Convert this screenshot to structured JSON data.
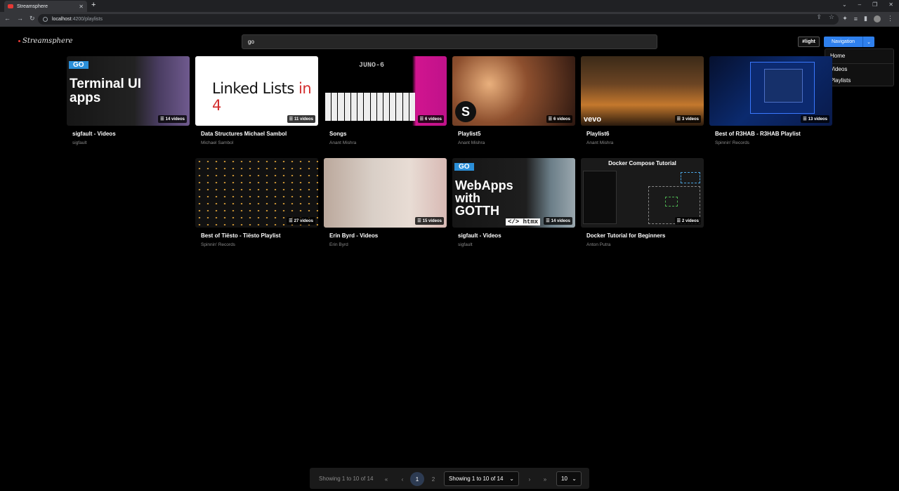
{
  "browser": {
    "tab_title": "Streamsphere",
    "url_host": "localhost",
    "url_path": ":4200/playlists"
  },
  "app": {
    "logo_text": "Streamsphere",
    "search_value": "go",
    "theme_button": "#light",
    "nav_button": "Navigation",
    "nav_menu": [
      "Home",
      "Videos",
      "Playlists"
    ]
  },
  "playlists": [
    {
      "title": "sigfault - Videos",
      "author": "sigfault",
      "count": "14 videos",
      "thumb_text": [
        "GO",
        "Terminal UI",
        "apps"
      ]
    },
    {
      "title": "Data Structures Michael Sambol",
      "author": "Michael Sambol",
      "count": "11 videos",
      "thumb_text": [
        "Linked Lists ",
        "in 4"
      ]
    },
    {
      "title": "Songs",
      "author": "Anant Mishra",
      "count": "6 videos",
      "thumb_text": [
        "JUNO-6"
      ]
    },
    {
      "title": "Playlist5",
      "author": "Anant Mishra",
      "count": "6 videos",
      "thumb_text": [
        "S"
      ]
    },
    {
      "title": "Playlist6",
      "author": "Anant Mishra",
      "count": "3 videos",
      "thumb_text": [
        "vevo"
      ]
    },
    {
      "title": "Best of R3HAB - R3HAB Playlist",
      "author": "Spinnin' Records",
      "count": "13 videos",
      "thumb_text": []
    },
    {
      "title": "Best of Tiësto - Tiësto Playlist",
      "author": "Spinnin' Records",
      "count": "27 videos",
      "thumb_text": []
    },
    {
      "title": "Erin Byrd - Videos",
      "author": "Erin Byrd",
      "count": "15 videos",
      "thumb_text": []
    },
    {
      "title": "sigfault - Videos",
      "author": "sigfault",
      "count": "14 videos",
      "thumb_text": [
        "GO",
        "WebApps",
        "with",
        "GOTTH",
        "</> htmx"
      ]
    },
    {
      "title": "Docker Tutorial for Beginners",
      "author": "Anton Putra",
      "count": "2 videos",
      "thumb_text": [
        "Docker Compose Tutorial"
      ]
    }
  ],
  "pagination": {
    "info": "Showing 1 to 10 of 14",
    "pages": [
      "1",
      "2"
    ],
    "current_page": "1",
    "report_select": "Showing 1 to 10 of 14",
    "rows_per_page": "10"
  }
}
